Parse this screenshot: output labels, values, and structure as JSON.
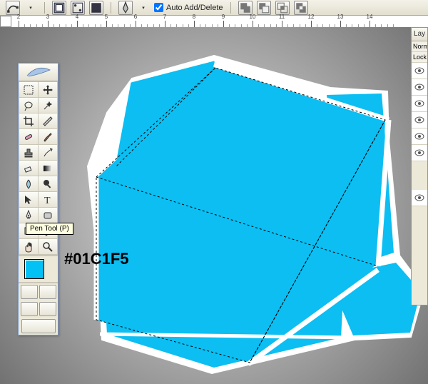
{
  "options": {
    "auto_add_delete": "Auto Add/Delete",
    "checked": true
  },
  "ruler": {
    "numbers": [
      2,
      3,
      4,
      5,
      6,
      7,
      8,
      9,
      10,
      11,
      12,
      13,
      14
    ],
    "spacing": 41,
    "offset": 26
  },
  "toolbox": {
    "tooltip": "Pen Tool (P)",
    "color_hex": "#01C1F5",
    "fg_color": "#01c1f5"
  },
  "layers": {
    "tab": "Lay",
    "mode": "Norm",
    "lock": "Lock"
  },
  "icons": {
    "feather": "feather",
    "marquee": "marquee",
    "move": "move",
    "lasso": "lasso",
    "wand": "wand",
    "crop": "crop",
    "slice": "slice",
    "heal": "heal",
    "brush": "brush",
    "stamp": "stamp",
    "history": "history",
    "eraser": "eraser",
    "grad": "grad",
    "blur": "blur",
    "dodge": "dodge",
    "select": "select",
    "type": "type",
    "pen": "pen",
    "shape": "shape",
    "notes": "notes",
    "eyedrop": "eyedrop",
    "hand": "hand",
    "zoom": "zoom"
  }
}
